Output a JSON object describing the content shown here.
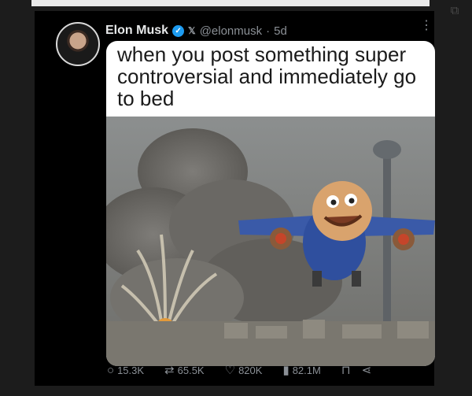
{
  "tweet": {
    "author_name": "Elon Musk",
    "handle": "@elonmusk",
    "separator": "·",
    "time": "5d",
    "caption": "when you post something super controversial and immediately go to bed"
  },
  "actions": {
    "replies": "15.3K",
    "reposts": "65.5K",
    "likes": "820K",
    "views": "82.1M"
  },
  "icons": {
    "verified": "verified-badge-icon",
    "x_logo": "x-logo-icon",
    "more": "more-options-icon",
    "reply": "reply-icon",
    "repost": "repost-icon",
    "like": "heart-icon",
    "views": "views-chart-icon",
    "bookmark": "bookmark-icon",
    "share": "share-icon"
  },
  "colors": {
    "background": "#000000",
    "verified": "#1d9bf0",
    "secondary_text": "#8b9096"
  }
}
